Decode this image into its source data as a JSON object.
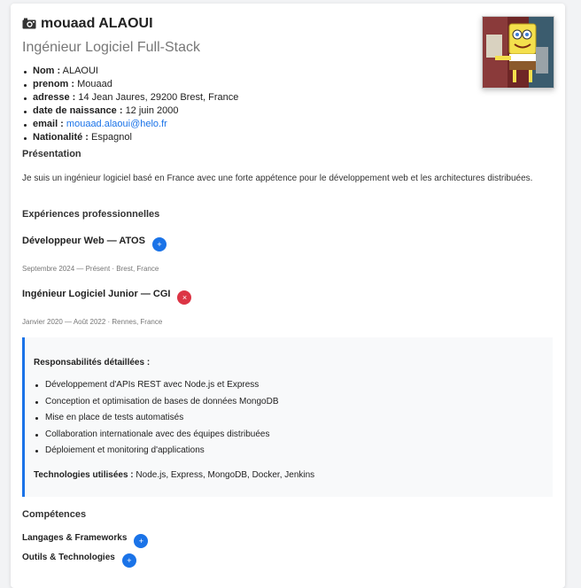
{
  "header": {
    "name": "mouaad ALAOUI",
    "subtitle": "Ingénieur Logiciel Full-Stack",
    "camera_icon": "camera-icon",
    "photo_alt": "profile-photo"
  },
  "info": [
    {
      "label": "Nom :",
      "value": "ALAOUI"
    },
    {
      "label": "prenom :",
      "value": "Mouaad"
    },
    {
      "label": "adresse :",
      "value": "14 Jean Jaures, 29200 Brest, France"
    },
    {
      "label": "date de naissance :",
      "value": "12 juin 2000"
    },
    {
      "label": "email :",
      "value": "mouaad.alaoui@helo.fr"
    },
    {
      "label": "Nationalité :",
      "value": "Espagnol"
    }
  ],
  "presentation": {
    "title": "Présentation",
    "text": "Je suis un ingénieur logiciel basé en France avec une forte appétence pour le développement web et les architectures distribuées."
  },
  "experience": {
    "title": "Expériences professionnelles",
    "jobs": [
      {
        "title": "Développeur Web — ATOS",
        "toggle": "+",
        "meta": "Septembre 2024 — Présent · Brest, France"
      },
      {
        "title": "Ingénieur Logiciel Junior — CGI",
        "toggle": "×",
        "meta": "Janvier 2020 — Août 2022 · Rennes, France"
      }
    ],
    "details": {
      "title": "Responsabilités détaillées :",
      "items": [
        "Développement d'APIs REST avec Node.js et Express",
        "Conception et optimisation de bases de données MongoDB",
        "Mise en place de tests automatisés",
        "Collaboration internationale avec des équipes distribuées",
        "Déploiement et monitoring d'applications"
      ],
      "tech_label": "Technologies utilisées :",
      "tech_value": "Node.js, Express, MongoDB, Docker, Jenkins"
    }
  },
  "skills": {
    "title": "Compétences",
    "groups": [
      {
        "label": "Langages & Frameworks",
        "toggle": "+"
      },
      {
        "label": "Outils & Technologies",
        "toggle": "+"
      }
    ]
  },
  "colors": {
    "accent": "#1a73e8",
    "danger": "#dc3545"
  }
}
